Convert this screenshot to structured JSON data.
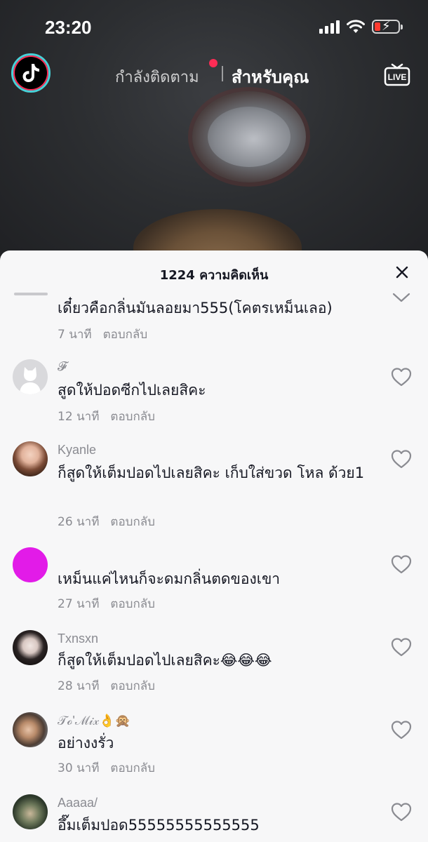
{
  "status_bar": {
    "time": "23:20",
    "icons": [
      "cellular-signal-icon",
      "wifi-icon",
      "battery-charging-icon"
    ],
    "battery_color": "#ff3b30"
  },
  "top_nav": {
    "logo_icon": "tiktok-logo-icon",
    "tab_following": "กำลังติดตาม",
    "tab_for_you": "สำหรับคุณ",
    "live_label": "LIVE",
    "notification_dot_color": "#fe2c55"
  },
  "comments_sheet": {
    "title": "1224 ความคิดเห็น",
    "close_icon": "close-icon",
    "reply_label": "ตอบกลับ",
    "comments": [
      {
        "username": "",
        "text": "เดี๋ยวคือกลิ่นมันลอยมา555(โคตรเหม็นเลอ)",
        "time": "7 นาที",
        "avatar": "cropped"
      },
      {
        "username": "𝓕",
        "text": "สูดให้ปอดซีกไปเลยสิคะ",
        "time": "12 นาที",
        "avatar": "default-avatar"
      },
      {
        "username": "Kyanle",
        "text": "ก็สูดให้เต็มปอดไปเลยสิคะ เก็บใส่ขวด โหล ด้วย1",
        "time": "26 นาที",
        "avatar": "photo"
      },
      {
        "username": "",
        "text": "เหม็นแค่ไหนก็จะดมกลิ่นตดของเขา",
        "time": "27 นาที",
        "avatar": "magenta"
      },
      {
        "username": "Txnsxn",
        "text": "ก็สูดให้เต็มปอดไปเลยสิคะ😂😂😂",
        "time": "28 นาที",
        "avatar": "photo"
      },
      {
        "username": "𝒯ℴ'ℳ𝒾𝓍👌🙊",
        "text": "อย่างงรั่ว",
        "time": "30 นาที",
        "avatar": "photo"
      },
      {
        "username": "Aaaaa/",
        "text": "อึ๊มเต็มปอด55555555555555",
        "time": "",
        "avatar": "photo"
      }
    ]
  },
  "colors": {
    "sheet_bg": "#f7f7f8",
    "text_primary": "#161823",
    "text_secondary": "#8a8b91",
    "magenta_avatar": "#e21be8"
  }
}
